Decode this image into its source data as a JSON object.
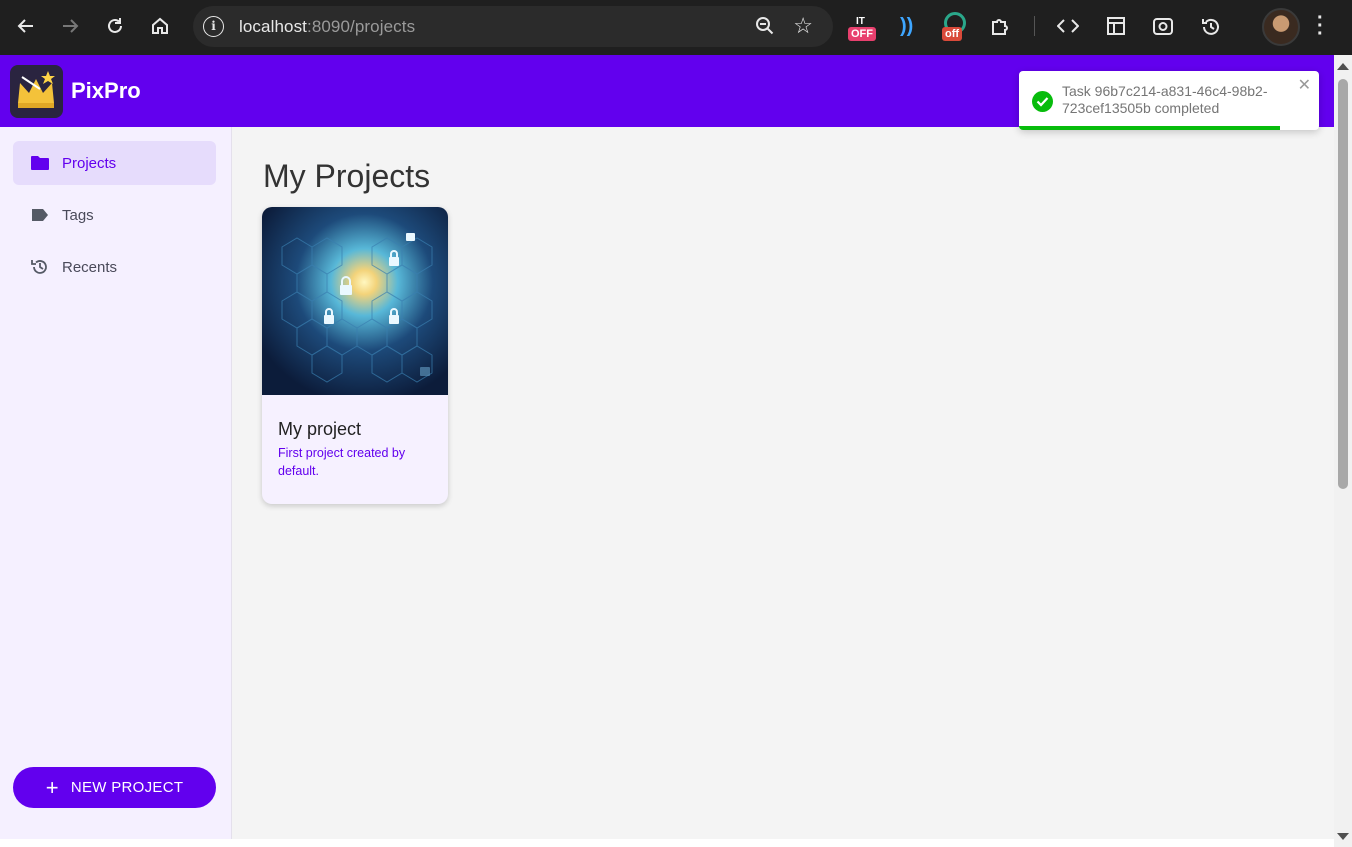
{
  "browser": {
    "url_host": "localhost",
    "url_rest": ":8090/projects",
    "ext_badge_1": "OFF",
    "ext_badge_2": "off"
  },
  "app": {
    "title": "PixPro"
  },
  "sidebar": {
    "items": [
      {
        "label": "Projects",
        "icon": "folder-icon",
        "active": true
      },
      {
        "label": "Tags",
        "icon": "tag-icon",
        "active": false
      },
      {
        "label": "Recents",
        "icon": "history-icon",
        "active": false
      }
    ],
    "new_project_label": "NEW PROJECT"
  },
  "main": {
    "page_title": "My Projects",
    "projects": [
      {
        "title": "My project",
        "description": "First project created by default."
      }
    ]
  },
  "toast": {
    "message": "Task 96b7c214-a831-46c4-98b2-723cef13505b completed",
    "progress_fraction": 0.87,
    "status_color": "#07bc0c"
  },
  "colors": {
    "accent": "#6200ee"
  }
}
